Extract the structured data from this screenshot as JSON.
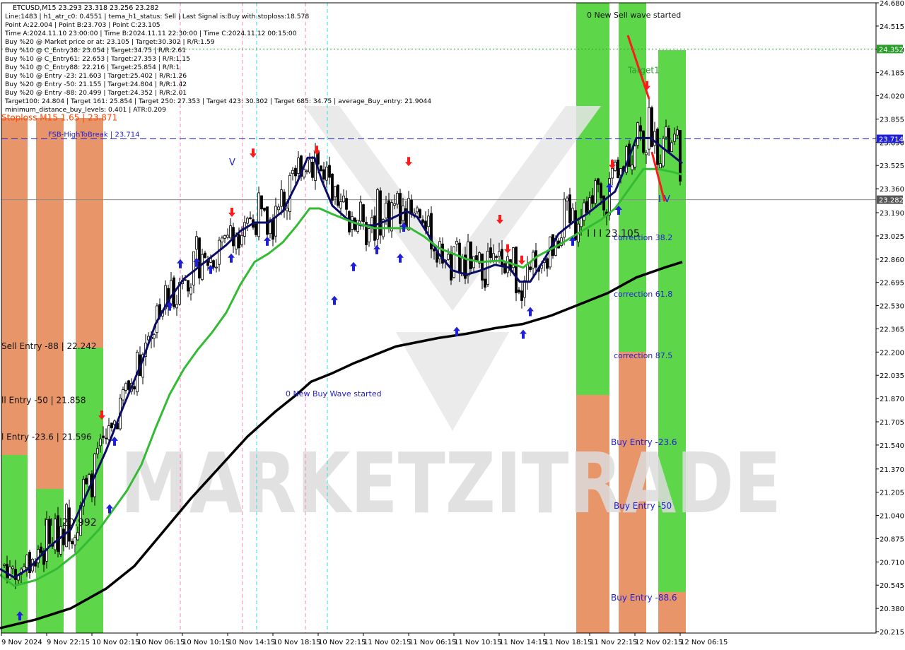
{
  "chart_data": {
    "type": "candlestick",
    "symbol_header": "ETCUSD,M15  23.293 23.318 23.256 23.282",
    "info_lines": [
      "Line:1483  |  h1_atr_c0: 0.4551  |  tema_h1_status: Sell  |  Last Signal is:Buy with stoploss:18.578",
      "Point A:22.004  |  Point B:23.703  |  Point C:23.105",
      "Time A:2024.11.10 23:00:00  |  Time B:2024.11.11 22:30:00  |  Time C:2024.11.12 00:15:00",
      "Buy %20 @ Market price or at: 23.105  |  Target:30.302  |  R/R:1.59",
      "Buy %10 @ C_Entry38: 23.054  |  Target:34.75  |  R/R:2.61",
      "Buy %10 @ C_Entry61: 22.653  |  Target:27.353  |  R/R:1.15",
      "Buy %10 @ C_Entry88: 22.216  |  Target:25.854  |  R/R:1",
      "Buy %10 @ Entry -23: 21.603  |  Target:25.402  |  R/R:1.26",
      "Buy %20 @ Entry -50: 21.155  |  Target:24.804  |  R/R:1.42",
      "Buy %20 @ Entry -88: 20.499  |  Target:24.352  |  R/R:2.01",
      "Target100: 24.804  |  Target 161: 25.854  |  Target 250: 27.353  |  Target 423: 30.302  |  Target 685: 34.75  |  average_Buy_entry: 21.9044",
      "minimum_distance_buy_levels: 0.401  |  ATR:0.209"
    ],
    "y_axis": {
      "range": [
        20.205,
        24.68
      ],
      "ticks": [
        "24.680",
        "24.515",
        "24.350",
        "24.185",
        "24.020",
        "23.855",
        "23.690",
        "23.525",
        "23.360",
        "23.190",
        "23.025",
        "22.860",
        "22.695",
        "22.530",
        "22.365",
        "22.200",
        "22.035",
        "21.870",
        "21.705",
        "21.540",
        "21.370",
        "21.205",
        "21.040",
        "20.875",
        "20.710",
        "20.545",
        "20.380",
        "20.215"
      ],
      "badges": [
        {
          "label": "24.352",
          "value": 24.352,
          "color": "#2a9d2a"
        },
        {
          "label": "23.714",
          "value": 23.714,
          "color": "#1f1fd6"
        },
        {
          "label": "23.282",
          "value": 23.282,
          "color": "#555555"
        }
      ]
    },
    "x_axis": {
      "ticks": [
        "9 Nov 2024",
        "9 Nov 22:15",
        "10 Nov 02:15",
        "10 Nov 06:15",
        "10 Nov 10:15",
        "10 Nov 14:15",
        "10 Nov 18:15",
        "10 Nov 22:15",
        "11 Nov 02:15",
        "11 Nov 06:15",
        "11 Nov 10:15",
        "11 Nov 14:15",
        "11 Nov 18:15",
        "11 Nov 22:15",
        "12 Nov 02:15",
        "12 Nov 06:15"
      ]
    },
    "levels": [
      {
        "label": "Stoploss M15 1.65 | 23.871",
        "value": 23.871,
        "color": "#ff4400"
      },
      {
        "label": "FSB-HighToBreak | 23.714",
        "value": 23.714,
        "color": "#1f1fd6"
      },
      {
        "label": "Target1",
        "value": 24.352,
        "color": "#2a9d2a"
      },
      {
        "label": "Sell Entry -88 | 22.242",
        "value": 22.242,
        "color": "#111111"
      },
      {
        "label": "ll Entry -50 | 21.858",
        "value": 21.858,
        "color": "#111111"
      },
      {
        "label": "l Entry -23.6 | 21.596",
        "value": 21.596,
        "color": "#111111"
      },
      {
        "label": "I I I 20.992",
        "value": 20.992,
        "color": "#111111"
      },
      {
        "label": "I I I 23.105",
        "value": 23.105,
        "color": "#111111"
      }
    ],
    "annotations": [
      {
        "text": "0 New Sell wave started",
        "color": "#111111"
      },
      {
        "text": "0 New Buy Wave started",
        "color": "#1f1fd6"
      },
      {
        "text": "correction 38.2",
        "color": "#1f1fd6"
      },
      {
        "text": "correction 61.8",
        "color": "#1f1fd6"
      },
      {
        "text": "correction 87.5",
        "color": "#1f1fd6"
      },
      {
        "text": "Buy Entry -23.6",
        "color": "#1f1fd6"
      },
      {
        "text": "Buy Entry -50",
        "color": "#1f1fd6"
      },
      {
        "text": "Buy Entry -88.6",
        "color": "#1f1fd6"
      },
      {
        "text": "V",
        "color": "#1f1fd6"
      },
      {
        "text": "I V",
        "color": "#1f1fd6"
      }
    ],
    "watermark": "MARKETZITRADE",
    "series": [
      {
        "color": "#0c0c66",
        "points": [
          [
            0,
            20.66
          ],
          [
            20,
            20.6
          ],
          [
            40,
            20.66
          ],
          [
            70,
            20.82
          ],
          [
            100,
            20.94
          ],
          [
            125,
            21.22
          ],
          [
            150,
            21.5
          ],
          [
            175,
            21.82
          ],
          [
            200,
            22.12
          ],
          [
            220,
            22.4
          ],
          [
            240,
            22.58
          ],
          [
            260,
            22.72
          ],
          [
            280,
            22.8
          ],
          [
            300,
            22.88
          ],
          [
            320,
            22.96
          ],
          [
            340,
            23.06
          ],
          [
            360,
            23.12
          ],
          [
            380,
            23.12
          ],
          [
            400,
            23.2
          ],
          [
            420,
            23.4
          ],
          [
            435,
            23.58
          ],
          [
            445,
            23.58
          ],
          [
            455,
            23.42
          ],
          [
            470,
            23.24
          ],
          [
            490,
            23.15
          ],
          [
            510,
            23.1
          ],
          [
            530,
            23.1
          ],
          [
            550,
            23.14
          ],
          [
            575,
            23.2
          ],
          [
            590,
            23.16
          ],
          [
            605,
            23.04
          ],
          [
            620,
            22.9
          ],
          [
            640,
            22.78
          ],
          [
            660,
            22.75
          ],
          [
            680,
            22.78
          ],
          [
            700,
            22.82
          ],
          [
            720,
            22.8
          ],
          [
            735,
            22.7
          ],
          [
            750,
            22.7
          ],
          [
            770,
            22.86
          ],
          [
            790,
            23.04
          ],
          [
            810,
            23.12
          ],
          [
            830,
            23.18
          ],
          [
            850,
            23.26
          ],
          [
            870,
            23.34
          ],
          [
            885,
            23.52
          ],
          [
            900,
            23.72
          ],
          [
            920,
            23.72
          ],
          [
            945,
            23.62
          ],
          [
            965,
            23.54
          ]
        ]
      },
      {
        "color": "#33bb33",
        "points": [
          [
            0,
            20.62
          ],
          [
            20,
            20.54
          ],
          [
            50,
            20.58
          ],
          [
            80,
            20.66
          ],
          [
            110,
            20.78
          ],
          [
            140,
            20.94
          ],
          [
            160,
            21.08
          ],
          [
            180,
            21.22
          ],
          [
            200,
            21.4
          ],
          [
            220,
            21.66
          ],
          [
            240,
            21.9
          ],
          [
            260,
            22.08
          ],
          [
            280,
            22.22
          ],
          [
            300,
            22.34
          ],
          [
            320,
            22.48
          ],
          [
            340,
            22.68
          ],
          [
            360,
            22.84
          ],
          [
            380,
            22.9
          ],
          [
            400,
            22.98
          ],
          [
            420,
            23.1
          ],
          [
            438,
            23.22
          ],
          [
            452,
            23.22
          ],
          [
            470,
            23.18
          ],
          [
            500,
            23.12
          ],
          [
            530,
            23.08
          ],
          [
            560,
            23.08
          ],
          [
            580,
            23.08
          ],
          [
            600,
            23.02
          ],
          [
            620,
            22.94
          ],
          [
            640,
            22.9
          ],
          [
            660,
            22.86
          ],
          [
            680,
            22.84
          ],
          [
            710,
            22.85
          ],
          [
            740,
            22.8
          ],
          [
            760,
            22.88
          ],
          [
            790,
            22.96
          ],
          [
            810,
            23.02
          ],
          [
            830,
            23.08
          ],
          [
            850,
            23.14
          ],
          [
            870,
            23.22
          ],
          [
            890,
            23.36
          ],
          [
            910,
            23.5
          ],
          [
            930,
            23.5
          ],
          [
            950,
            23.48
          ],
          [
            965,
            23.46
          ]
        ]
      },
      {
        "color": "#000000",
        "points": [
          [
            0,
            20.24
          ],
          [
            50,
            20.3
          ],
          [
            100,
            20.38
          ],
          [
            150,
            20.52
          ],
          [
            190,
            20.68
          ],
          [
            230,
            20.92
          ],
          [
            270,
            21.16
          ],
          [
            310,
            21.38
          ],
          [
            350,
            21.6
          ],
          [
            390,
            21.78
          ],
          [
            420,
            21.9
          ],
          [
            440,
            21.99
          ],
          [
            470,
            22.05
          ],
          [
            500,
            22.12
          ],
          [
            530,
            22.18
          ],
          [
            560,
            22.24
          ],
          [
            590,
            22.27
          ],
          [
            620,
            22.3
          ],
          [
            660,
            22.33
          ],
          [
            700,
            22.37
          ],
          [
            740,
            22.4
          ],
          [
            780,
            22.46
          ],
          [
            820,
            22.54
          ],
          [
            860,
            22.62
          ],
          [
            900,
            22.73
          ],
          [
            940,
            22.8
          ],
          [
            965,
            22.84
          ]
        ]
      }
    ]
  }
}
